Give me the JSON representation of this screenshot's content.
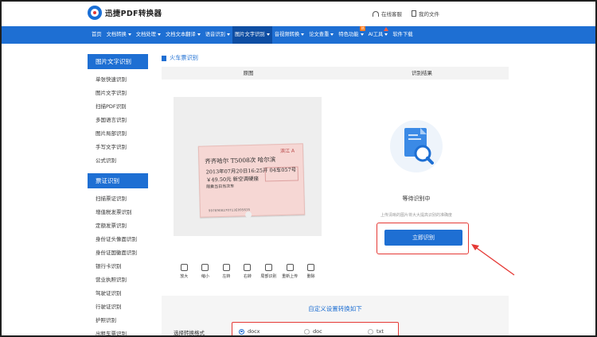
{
  "header": {
    "logo_text": "迅捷PDF转换器",
    "service_link": "在线客服",
    "my_files_link": "我的文件"
  },
  "nav": {
    "items": [
      {
        "label": "首页",
        "caret": false
      },
      {
        "label": "文档转换",
        "caret": true
      },
      {
        "label": "文档处理",
        "caret": true
      },
      {
        "label": "文档文本翻译",
        "caret": true
      },
      {
        "label": "语音识别",
        "caret": true
      },
      {
        "label": "图片文字识别",
        "caret": true,
        "active": true
      },
      {
        "label": "音视频转换",
        "caret": true
      },
      {
        "label": "论文查重",
        "caret": true
      },
      {
        "label": "特色功能",
        "caret": true,
        "badge": "hot"
      },
      {
        "label": "AI工具",
        "caret": true,
        "badge": "new"
      },
      {
        "label": "软件下载",
        "caret": false
      }
    ],
    "hot_badge": "热"
  },
  "sidebar": {
    "sections": [
      {
        "title": "图片文字识别",
        "items": [
          "单张快速识别",
          "图片文字识别",
          "扫描PDF识别",
          "多国语言识别",
          "图片局部识别",
          "手写文字识别",
          "公式识别"
        ]
      },
      {
        "title": "票证识别",
        "items": [
          "扫描票证识别",
          "增值税发票识别",
          "定额发票识别",
          "身份证头像面识别",
          "身份证国徽面识别",
          "银行卡识别",
          "营业执照识别",
          "驾驶证识别",
          "行驶证识别",
          "护照识别",
          "出租车票识别"
        ]
      }
    ]
  },
  "main": {
    "breadcrumb": "火车票识别",
    "tabs": [
      "原图",
      "识别结果"
    ],
    "ticket": {
      "station_no": "滨江 A",
      "from_to": "齐齐哈尔  T5008次  哈尔滨",
      "date_line": "2013年07月20日16:25开  04车057号",
      "price_line": "￥49.50元  新空调硬座",
      "sub_line": "限乘当日当次车",
      "serial": "9976908270713E095635"
    },
    "tools": [
      {
        "label": "放大",
        "icon": "zoom-in-icon"
      },
      {
        "label": "缩小",
        "icon": "zoom-out-icon"
      },
      {
        "label": "左转",
        "icon": "rotate-left-icon"
      },
      {
        "label": "右转",
        "icon": "rotate-right-icon"
      },
      {
        "label": "局部识别",
        "icon": "crop-icon"
      },
      {
        "label": "重新上传",
        "icon": "refresh-icon"
      },
      {
        "label": "删除",
        "icon": "trash-icon"
      }
    ],
    "result": {
      "status": "等待识别中",
      "hint": "上传清晰的图片将大大提高识别的准确度",
      "button_label": "立即识别"
    },
    "settings": {
      "title": "自定义设置转换如下",
      "format_label": "选择转换格式",
      "options": [
        "docx",
        "doc",
        "txt"
      ],
      "selected": "docx"
    }
  },
  "colors": {
    "primary": "#1e6fd3",
    "highlight": "#e53935"
  }
}
